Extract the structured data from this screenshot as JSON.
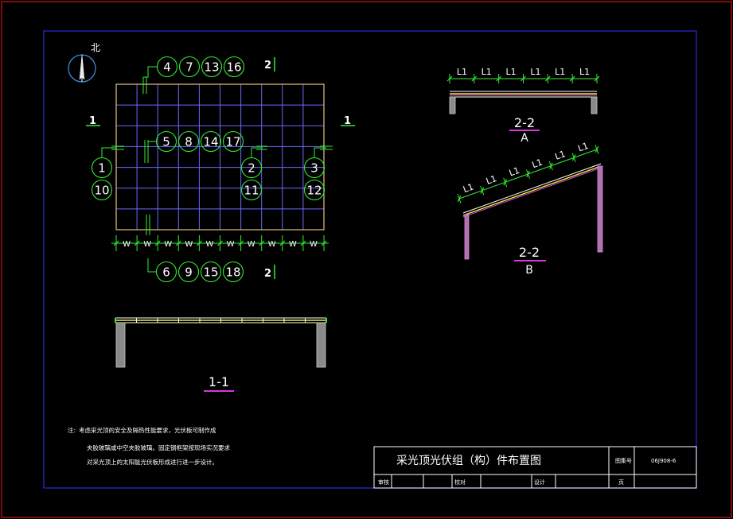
{
  "colors": {
    "background": "#000000",
    "outer_border": "#c81414",
    "inner_border": "#2a2ad8",
    "grid_outline": "#e8c080",
    "grid_lines": "#6a6aff",
    "callouts": "#33ee33",
    "section_label": "#ffffff",
    "section_underline": "#dd33dd",
    "wall_fill": "#9a9a9a",
    "column_fill": "#b070b0",
    "white": "#ffffff",
    "yellow": "#eeee44"
  },
  "north_arrow": {
    "label": "北",
    "icon": "north-arrow-icon"
  },
  "plan": {
    "rows": 7,
    "cols": 10,
    "top_callouts": [
      "4",
      "7",
      "13",
      "16"
    ],
    "middle_callouts": [
      "5",
      "8",
      "14",
      "17"
    ],
    "bottom_callouts": [
      "6",
      "9",
      "15",
      "18"
    ],
    "left_callouts": [
      "1",
      "10"
    ],
    "center_right_callouts": [
      "2",
      "11"
    ],
    "right_callouts": [
      "3",
      "12"
    ],
    "w_label": "W",
    "section_1_mark": "1",
    "section_2_mark": "2"
  },
  "sections": {
    "s11": {
      "label": "1-1"
    },
    "s22a": {
      "label": "2-2",
      "sub": "A",
      "dim_label": "L1",
      "dim_count": 6
    },
    "s22b": {
      "label": "2-2",
      "sub": "B",
      "dim_label": "L1",
      "dim_count": 6
    }
  },
  "notes": {
    "prefix": "注:",
    "lines": [
      "考虑采光顶的安全及隔热性能要求，光伏板可制作成",
      "夹胶玻璃或中空夹胶玻璃。固定钢框架按现场实况要求",
      "对采光顶上的太阳能光伏板形成进行进一步设计。"
    ]
  },
  "title_block": {
    "title": "采光顶光伏组（构）件布置图",
    "atlas_label": "图集号",
    "atlas_number": "06J908-6",
    "review_label": "审核",
    "check_label": "校对",
    "design_label": "设计",
    "page_label": "页"
  }
}
